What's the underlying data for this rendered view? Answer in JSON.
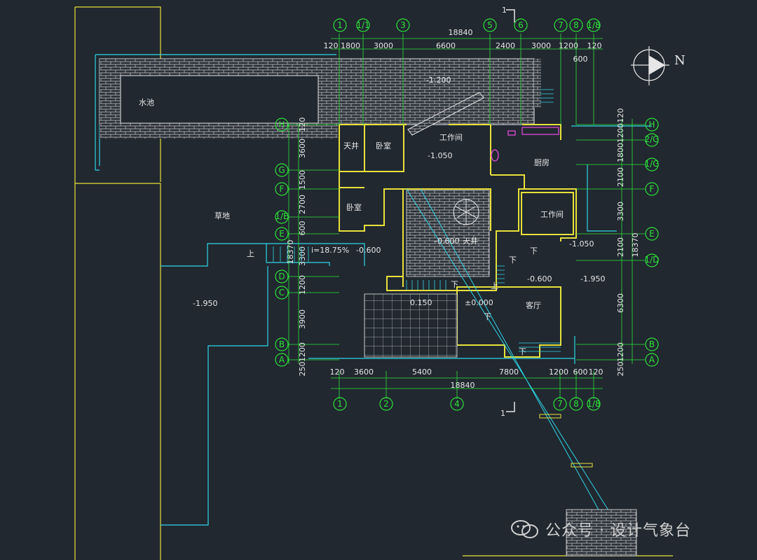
{
  "top_dims": {
    "total": "18840",
    "segments": [
      "120",
      "1800",
      "3000",
      "6600",
      "2400",
      "3000",
      "1200",
      "120"
    ],
    "extra": "600"
  },
  "bottom_dims": {
    "total": "18840",
    "segments": [
      "120",
      "3600",
      "5400",
      "7800",
      "1200",
      "600",
      "120"
    ]
  },
  "right_dims": {
    "total": "18370",
    "segments": [
      "120",
      "1200",
      "1800",
      "2100",
      "3300",
      "2100",
      "6300",
      "1200",
      "250"
    ]
  },
  "left_dims": {
    "total": "18370",
    "segments": [
      "120",
      "3600",
      "1500",
      "2700",
      "600",
      "3300",
      "1200",
      "3900",
      "1200",
      "250"
    ]
  },
  "top_axes": [
    "1",
    "1/1",
    "3",
    "5",
    "6",
    "7",
    "8",
    "1/8"
  ],
  "bottom_axes": [
    "1",
    "2",
    "4",
    "7",
    "8",
    "1/8"
  ],
  "left_axes": [
    "H",
    "G",
    "F",
    "1/E",
    "E",
    "D",
    "C",
    "B",
    "A"
  ],
  "right_axes": [
    "H",
    "2/G",
    "1/G",
    "F",
    "E",
    "1/D",
    "B",
    "A"
  ],
  "section_mark": "1",
  "north": "N",
  "rooms": {
    "pool": "水池",
    "lawn": "草地",
    "patio": "天井",
    "bedroom1": "卧室",
    "bedroom2": "卧室",
    "workroom1": "工作间",
    "workroom2": "工作间",
    "kitchen": "厨房",
    "courtyard": "天井",
    "living": "客厅"
  },
  "levels": {
    "pool_deck": "-1.200",
    "workroom": "-1.050",
    "ramp": "i=18.75%",
    "ramp_lvl": "-0.600",
    "courtyard": "-0.600",
    "living": "-0.600",
    "right_lvl": "-1.950",
    "right_small": "-1.050",
    "lawn_lvl": "-1.950",
    "entry": "0.150",
    "zero": "±0.000"
  },
  "stair_marks": {
    "up": "上",
    "down": "下"
  },
  "watermark": "公众号 · 设计气象台"
}
